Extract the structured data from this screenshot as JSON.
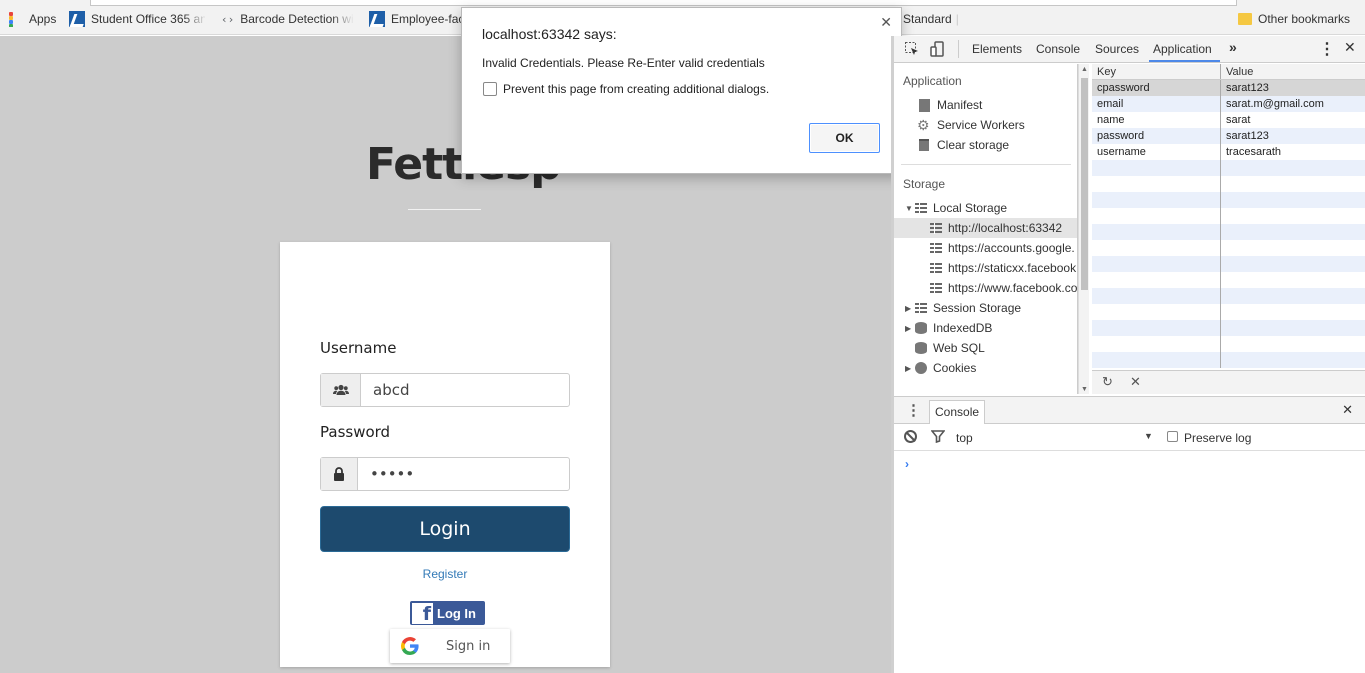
{
  "bookmarks": {
    "items": [
      {
        "label": "Apps"
      },
      {
        "label": "Student Office 365 an"
      },
      {
        "label": "Barcode Detection wi"
      },
      {
        "label": "Employee-fac"
      }
    ],
    "standard_label": "Standard",
    "other_label": "Other bookmarks",
    "apps_colors": [
      "#e8453c",
      "#f9bb2d",
      "#3b82f6",
      "#34a853",
      "#e8453c",
      "#f9bb2d",
      "#3b82f6",
      "#34a853",
      "#e8453c"
    ]
  },
  "page": {
    "brand": "Fettlesp",
    "username_label": "Username",
    "username_value": "abcd",
    "password_label": "Password",
    "password_value": "•••••",
    "login_label": "Login",
    "register_label": "Register",
    "facebook_label": "Log In",
    "google_label": "Sign in"
  },
  "dialog": {
    "title": "localhost:63342 says:",
    "message": "Invalid Credentials. Please Re-Enter valid credentials",
    "checkbox_label": "Prevent this page from creating additional dialogs.",
    "ok_label": "OK"
  },
  "devtools": {
    "tabs": [
      "Elements",
      "Console",
      "Sources",
      "Application"
    ],
    "active_tab": "Application",
    "sidebar": {
      "application_header": "Application",
      "application_items": [
        "Manifest",
        "Service Workers",
        "Clear storage"
      ],
      "storage_header": "Storage",
      "local_storage": "Local Storage",
      "origins": [
        "http://localhost:63342",
        "https://accounts.google.",
        "https://staticxx.facebook",
        "https://www.facebook.co"
      ],
      "session_storage": "Session Storage",
      "indexeddb": "IndexedDB",
      "websql": "Web SQL",
      "cookies": "Cookies"
    },
    "storage_table": {
      "headers": [
        "Key",
        "Value"
      ],
      "rows": [
        {
          "key": "cpassword",
          "value": "sarat123"
        },
        {
          "key": "email",
          "value": "sarat.m@gmail.com"
        },
        {
          "key": "name",
          "value": "sarat"
        },
        {
          "key": "password",
          "value": "sarat123"
        },
        {
          "key": "username",
          "value": "tracesarath"
        }
      ]
    },
    "drawer": {
      "tab_label": "Console",
      "context": "top",
      "preserve_log_label": "Preserve log",
      "prompt": "›"
    }
  },
  "colors": {
    "page_bg": "#cccccc",
    "login_button": "#1d4a6e",
    "facebook_blue": "#3b5998",
    "devtools_accent": "#4d88e8"
  }
}
